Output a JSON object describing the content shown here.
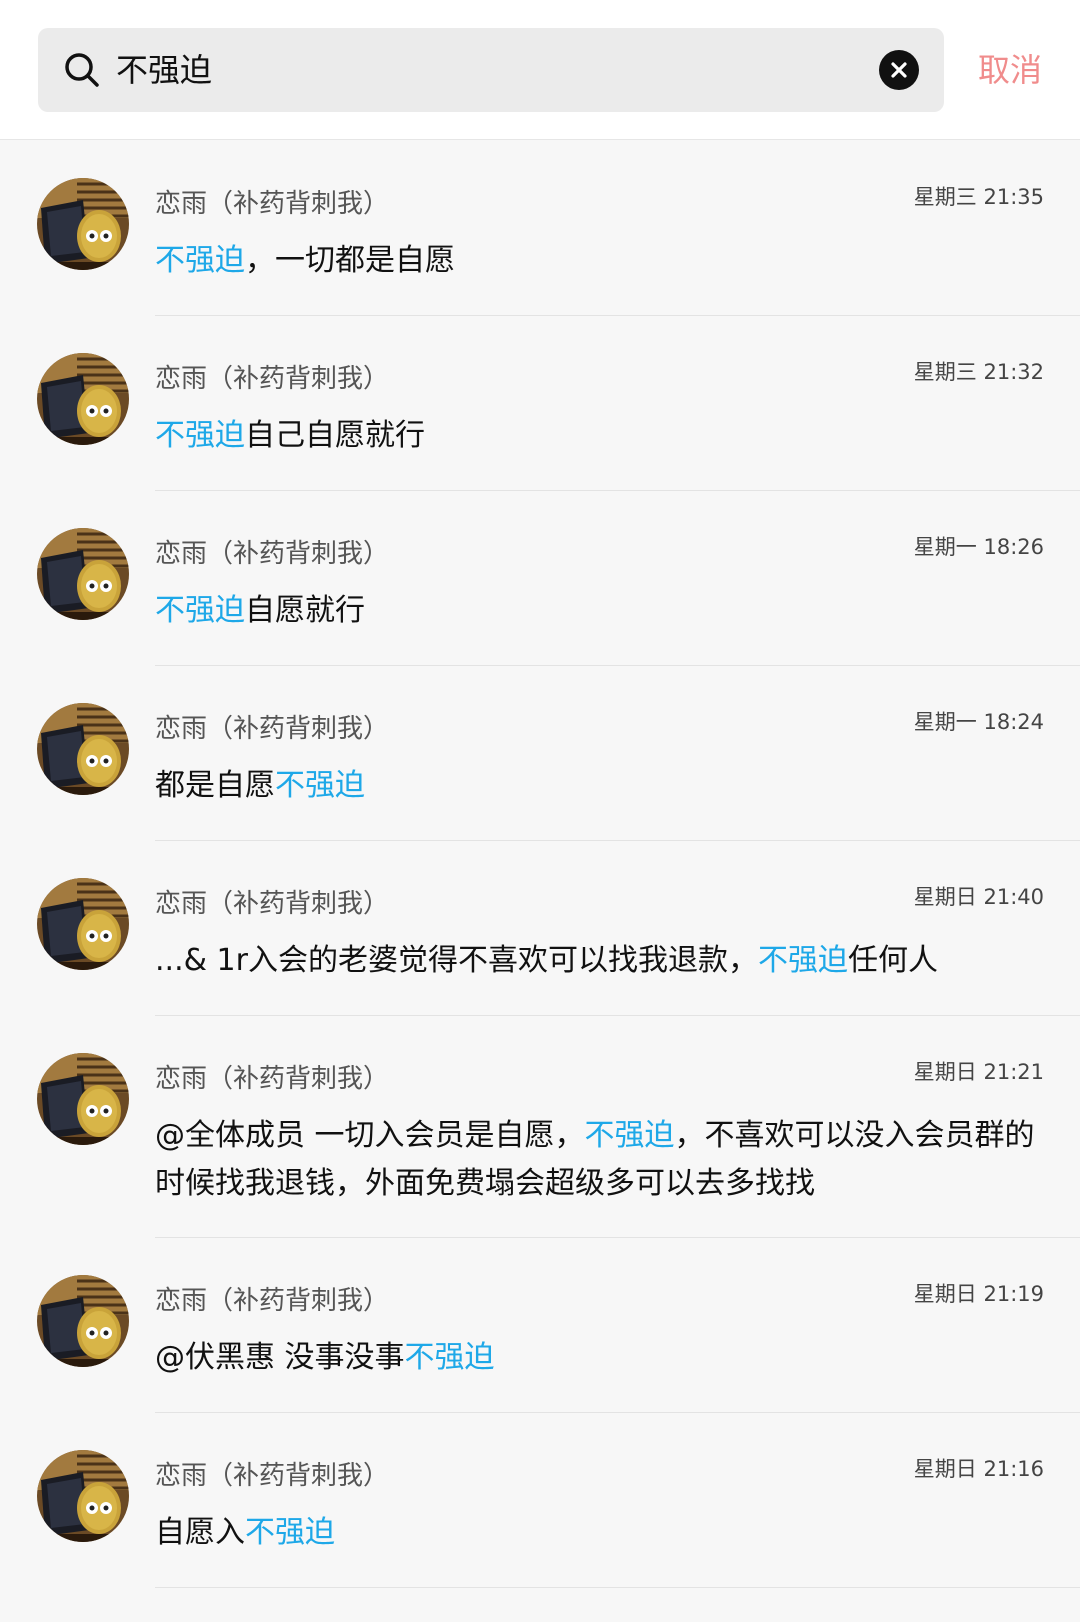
{
  "search": {
    "query": "不强迫",
    "cancel_label": "取消"
  },
  "results": [
    {
      "sender": "恋雨（补药背刺我）",
      "time": "星期三 21:35",
      "segments": [
        {
          "text": "不强迫",
          "hl": true
        },
        {
          "text": "，一切都是自愿",
          "hl": false
        }
      ]
    },
    {
      "sender": "恋雨（补药背刺我）",
      "time": "星期三 21:32",
      "segments": [
        {
          "text": "不强迫",
          "hl": true
        },
        {
          "text": "自己自愿就行",
          "hl": false
        }
      ]
    },
    {
      "sender": "恋雨（补药背刺我）",
      "time": "星期一 18:26",
      "segments": [
        {
          "text": "不强迫",
          "hl": true
        },
        {
          "text": "自愿就行",
          "hl": false
        }
      ]
    },
    {
      "sender": "恋雨（补药背刺我）",
      "time": "星期一 18:24",
      "segments": [
        {
          "text": "都是自愿",
          "hl": false
        },
        {
          "text": "不强迫",
          "hl": true
        }
      ]
    },
    {
      "sender": "恋雨（补药背刺我）",
      "time": "星期日 21:40",
      "segments": [
        {
          "text": "...& 1r入会的老婆觉得不喜欢可以找我退款，",
          "hl": false
        },
        {
          "text": "不强迫",
          "hl": true
        },
        {
          "text": "任何人",
          "hl": false
        }
      ]
    },
    {
      "sender": "恋雨（补药背刺我）",
      "time": "星期日 21:21",
      "segments": [
        {
          "text": "@全体成员  一切入会员是自愿，",
          "hl": false
        },
        {
          "text": "不强迫",
          "hl": true
        },
        {
          "text": "，不喜欢可以没入会员群的时候找我退钱，外面免费塌会超级多可以去多找找",
          "hl": false
        }
      ]
    },
    {
      "sender": "恋雨（补药背刺我）",
      "time": "星期日 21:19",
      "segments": [
        {
          "text": "@伏黑惠  没事没事",
          "hl": false
        },
        {
          "text": "不强迫",
          "hl": true
        }
      ]
    },
    {
      "sender": "恋雨（补药背刺我）",
      "time": "星期日 21:16",
      "segments": [
        {
          "text": "自愿入",
          "hl": false
        },
        {
          "text": "不强迫",
          "hl": true
        }
      ]
    }
  ],
  "colors": {
    "highlight": "#1ea8e8",
    "cancel": "#f08c8c"
  },
  "icons": {
    "search": "search-icon",
    "clear": "close-icon"
  }
}
